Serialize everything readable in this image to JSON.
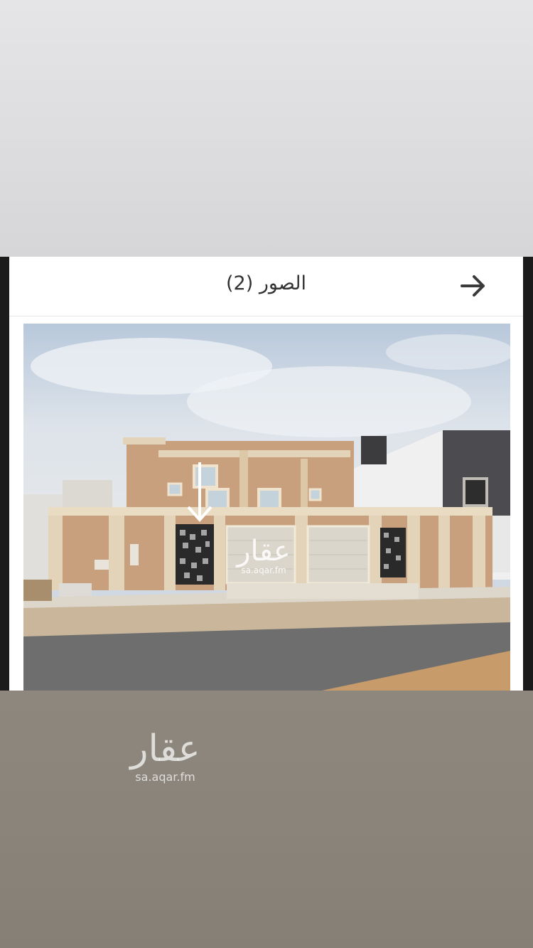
{
  "header": {
    "title": "الصور (2)",
    "back_icon": "arrow-right-icon"
  },
  "watermark": {
    "logo_text": "عقار",
    "url": "sa.aqar.fm"
  },
  "colors": {
    "top_background": "#e2e2e4",
    "bottom_background": "#8a847a",
    "panel": "#ffffff",
    "header_text": "#333333",
    "arrow": "#3a3a3a"
  }
}
